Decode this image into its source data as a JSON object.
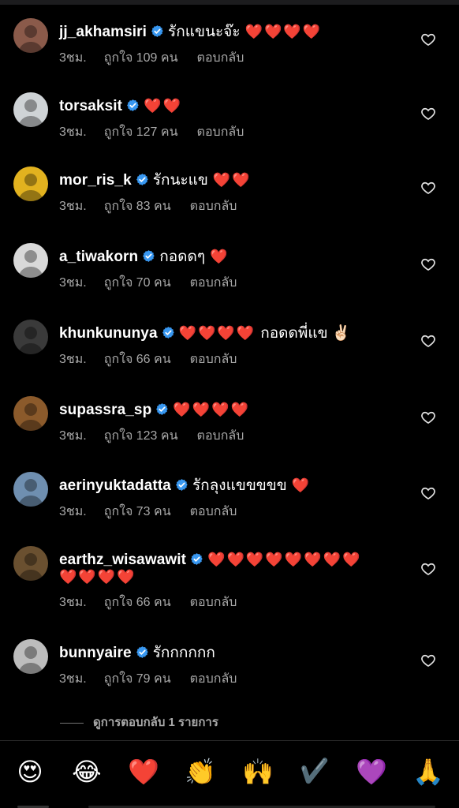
{
  "comments": [
    {
      "username": "jj_akhamsiri",
      "text": "รักแขนะจ๊ะ",
      "hearts": "❤️❤️❤️❤️",
      "hearts_cont": "",
      "time": "3ชม.",
      "likes": "ถูกใจ 109 คน",
      "reply": "ตอบกลับ",
      "avatar_color": "#8a5a4a",
      "avatar_icon": "person-photo-icon"
    },
    {
      "username": "torsaksit",
      "text": "",
      "hearts": "❤️❤️",
      "hearts_cont": "",
      "time": "3ชม.",
      "likes": "ถูกใจ 127 คน",
      "reply": "ตอบกลับ",
      "avatar_color": "#cfd3d6",
      "avatar_icon": "person-photo-icon"
    },
    {
      "username": "mor_ris_k",
      "text": "รักนะแข",
      "hearts": "❤️❤️",
      "hearts_cont": "",
      "time": "3ชม.",
      "likes": "ถูกใจ 83 คน",
      "reply": "ตอบกลับ",
      "avatar_color": "#e2b21f",
      "avatar_icon": "person-photo-icon"
    },
    {
      "username": "a_tiwakorn",
      "text": "กอดดๆ",
      "hearts": "❤️",
      "hearts_cont": "",
      "time": "3ชม.",
      "likes": "ถูกใจ 70 คน",
      "reply": "ตอบกลับ",
      "avatar_color": "#d9d9d9",
      "avatar_icon": "person-photo-icon"
    },
    {
      "username": "khunkununya",
      "text": "",
      "hearts": "❤️❤️❤️❤️",
      "after": "กอดดพี่แข ✌🏻",
      "hearts_cont": "",
      "time": "3ชม.",
      "likes": "ถูกใจ 66 คน",
      "reply": "ตอบกลับ",
      "avatar_color": "#3a3a3a",
      "avatar_icon": "person-photo-icon"
    },
    {
      "username": "supassra_sp",
      "text": "",
      "hearts": "❤️❤️❤️❤️",
      "hearts_cont": "",
      "time": "3ชม.",
      "likes": "ถูกใจ 123 คน",
      "reply": "ตอบกลับ",
      "avatar_color": "#8b5a2b",
      "avatar_icon": "person-photo-icon"
    },
    {
      "username": "aerinyuktadatta",
      "text": "รักลุงแขขขขข",
      "hearts": "❤️",
      "hearts_cont": "",
      "time": "3ชม.",
      "likes": "ถูกใจ 73 คน",
      "reply": "ตอบกลับ",
      "avatar_color": "#6f8fb0",
      "avatar_icon": "person-photo-icon"
    },
    {
      "username": "earthz_wisawawit",
      "text": "",
      "hearts": "❤️❤️❤️❤️❤️❤️❤️❤️",
      "hearts_cont": "❤️❤️❤️❤️",
      "time": "3ชม.",
      "likes": "ถูกใจ 66 คน",
      "reply": "ตอบกลับ",
      "avatar_color": "#6a5030",
      "avatar_icon": "person-photo-icon"
    },
    {
      "username": "bunnyaire",
      "text": "รักกกกกก",
      "hearts": "",
      "hearts_cont": "",
      "time": "3ชม.",
      "likes": "ถูกใจ 79 คน",
      "reply": "ตอบกลับ",
      "avatar_color": "#bdbdbd",
      "avatar_icon": "person-photo-icon"
    }
  ],
  "view_replies": "ดูการตอบกลับ 1 รายการ",
  "emoji_bar": [
    "😍",
    "😂",
    "❤️",
    "👏",
    "🙌",
    "✔️",
    "💜",
    "🙏"
  ],
  "colors": {
    "background": "#000000",
    "secondary_text": "#a8a8a8",
    "verified": "#3897f0"
  }
}
